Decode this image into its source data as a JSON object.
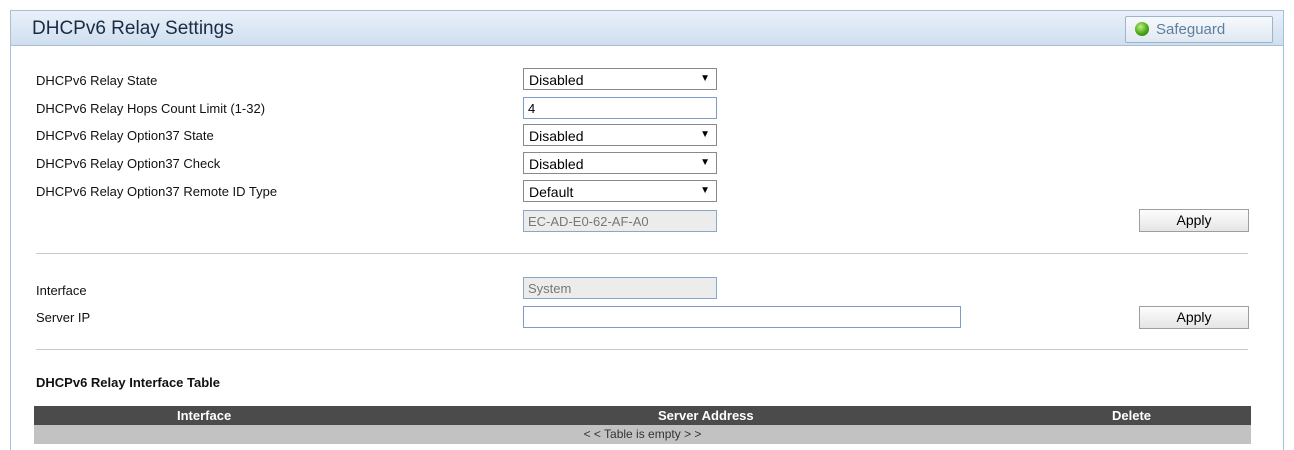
{
  "header": {
    "title": "DHCPv6 Relay Settings",
    "safeguard_label": "Safeguard",
    "safeguard_status_color": "#4aa61a"
  },
  "relay": {
    "state_label": "DHCPv6 Relay State",
    "state_value": "Disabled",
    "hops_label": "DHCPv6 Relay Hops Count Limit (1-32)",
    "hops_value": "4",
    "opt37_state_label": "DHCPv6 Relay Option37 State",
    "opt37_state_value": "Disabled",
    "opt37_check_label": "DHCPv6 Relay Option37 Check",
    "opt37_check_value": "Disabled",
    "remote_id_label": "DHCPv6 Relay Option37 Remote ID Type",
    "remote_id_value": "Default",
    "remote_id_mac": "EC-AD-E0-62-AF-A0",
    "apply_label": "Apply"
  },
  "interface_section": {
    "interface_label": "Interface",
    "interface_value": "System",
    "server_ip_label": "Server IP",
    "server_ip_value": "",
    "apply_label": "Apply"
  },
  "table": {
    "title": "DHCPv6 Relay Interface Table",
    "columns": [
      "Interface",
      "Server Address",
      "Delete"
    ],
    "empty_text": "< < Table is empty > >"
  }
}
